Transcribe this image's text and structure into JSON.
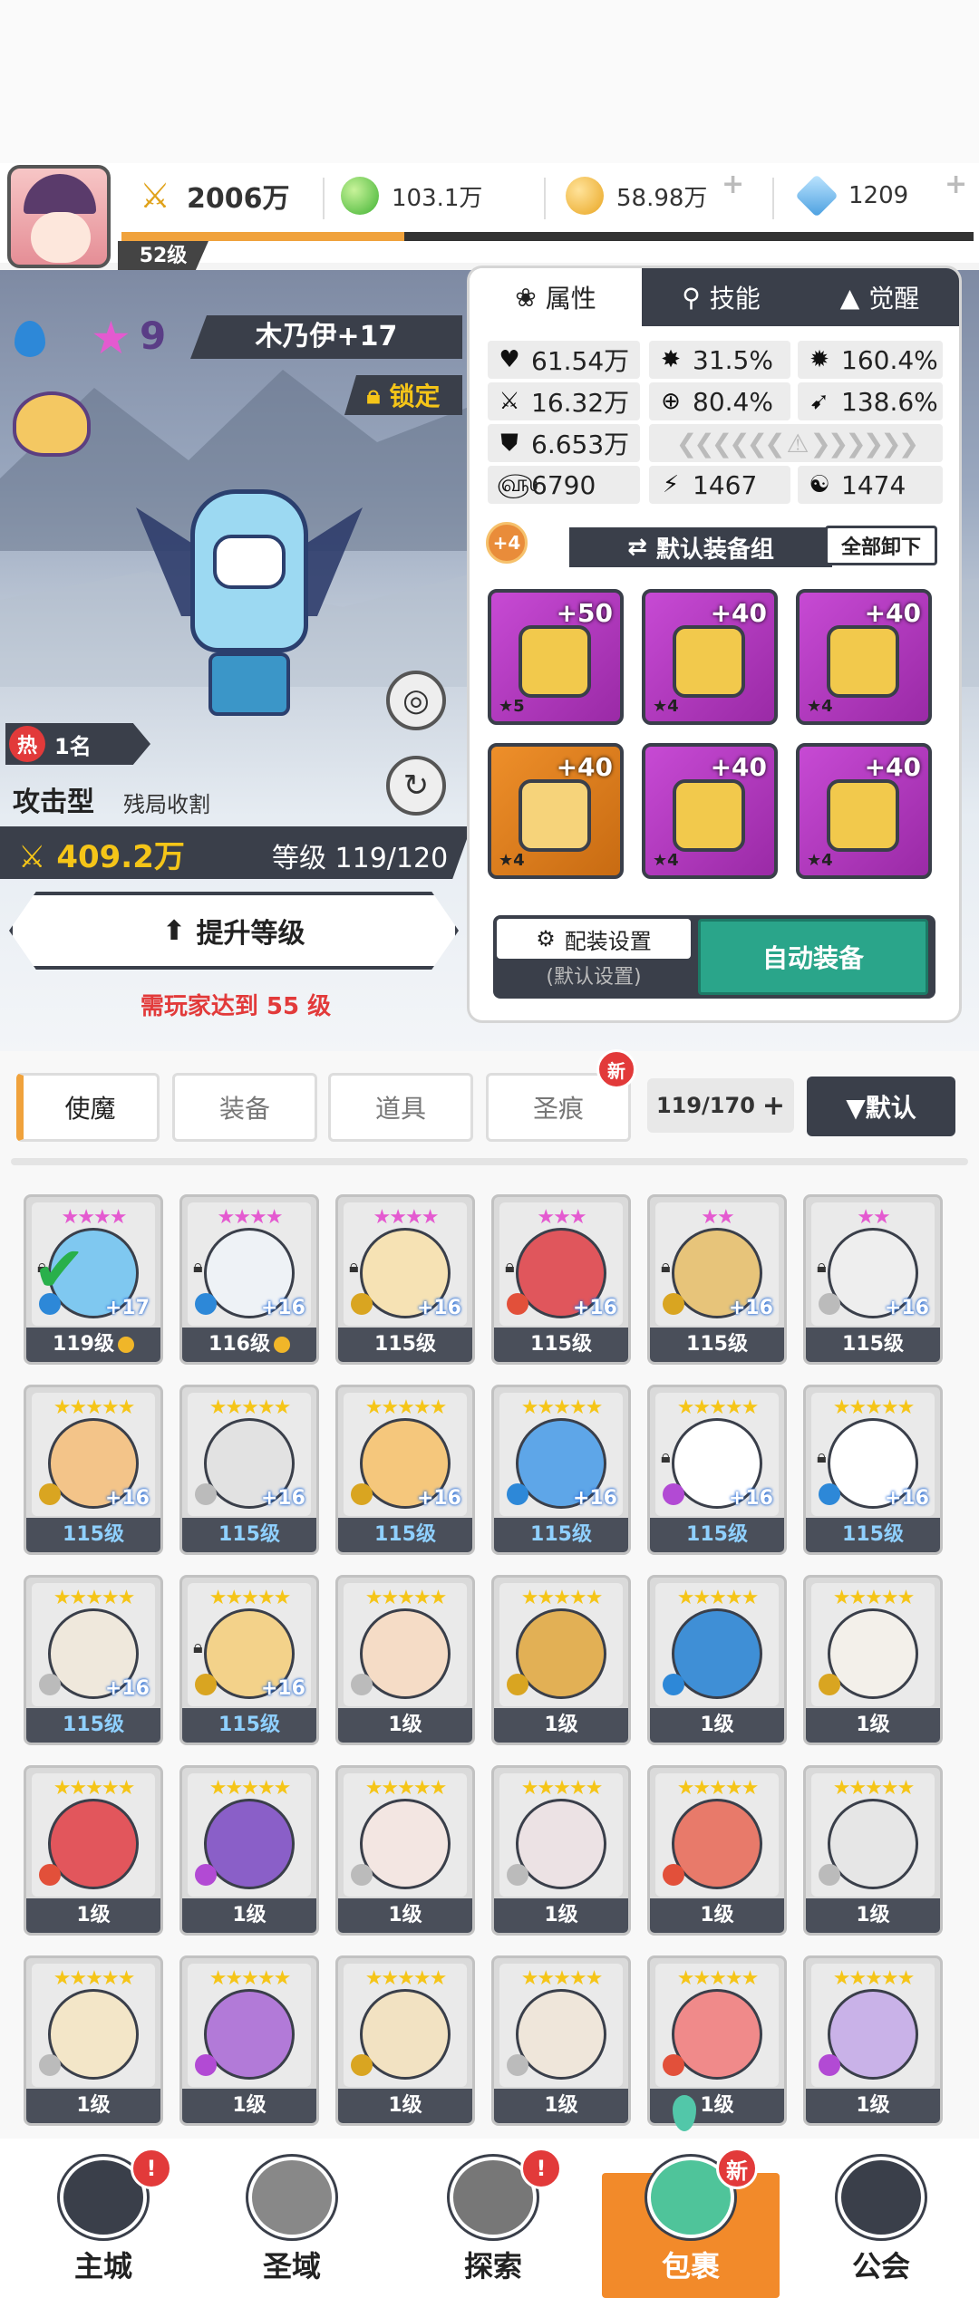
{
  "player": {
    "level": "52级"
  },
  "resources": {
    "power": "2006万",
    "gems": "103.1万",
    "gold": "58.98万",
    "crystal": "1209"
  },
  "hero": {
    "stars": "9",
    "name": "木乃伊+17",
    "lock_label": "锁定",
    "rank": "1名",
    "hot_label": "热",
    "role": "攻击型",
    "role_desc": "残局收割",
    "power": "409.2万",
    "level": "等级 119/120",
    "levelup_label": "提升等级",
    "requirement": "需玩家达到 55 级"
  },
  "stat_tabs": {
    "attr": "属性",
    "skill": "技能",
    "awaken": "觉醒"
  },
  "stats": {
    "hp": "61.54万",
    "crit_rate": "31.5%",
    "crit_dmg": "160.4%",
    "atk": "16.32万",
    "accuracy": "80.4%",
    "speed_pct": "138.6%",
    "def": "6.653万",
    "r1": "6790",
    "r2": "1467",
    "r3": "1474"
  },
  "equip": {
    "plus_badge": "+4",
    "set_name": "默认装备组",
    "unequip_all": "全部卸下",
    "items": [
      {
        "plus": "+50",
        "stars": "★5",
        "rarity": "purple",
        "icon": "sword-icon"
      },
      {
        "plus": "+40",
        "stars": "★4",
        "rarity": "purple",
        "icon": "helmet-icon"
      },
      {
        "plus": "+40",
        "stars": "★4",
        "rarity": "purple",
        "icon": "armor-icon"
      },
      {
        "plus": "+40",
        "stars": "★4",
        "rarity": "orange",
        "icon": "belt-icon"
      },
      {
        "plus": "+40",
        "stars": "★4",
        "rarity": "purple",
        "icon": "necklace-icon"
      },
      {
        "plus": "+40",
        "stars": "★4",
        "rarity": "purple",
        "icon": "boots-icon"
      }
    ],
    "config_label": "配装设置",
    "config_sub": "(默认设置)",
    "auto_equip": "自动装备"
  },
  "categories": {
    "shima": "使魔",
    "equip": "装备",
    "item": "道具",
    "sheng": "圣痕",
    "new_badge": "新"
  },
  "count": "119/170",
  "sort_label": "▼默认",
  "heroes": [
    {
      "stars": "★★★★",
      "level": "119级",
      "plus": "+17",
      "lock": true,
      "coin": true,
      "color": "#7fc8f0",
      "elem": "#2d88d8",
      "blue": false,
      "starColor": "#e45ad0"
    },
    {
      "stars": "★★★★",
      "level": "116级",
      "plus": "+16",
      "lock": true,
      "coin": true,
      "color": "#eef2f6",
      "elem": "#2d88d8",
      "blue": false,
      "starColor": "#e45ad0"
    },
    {
      "stars": "★★★★",
      "level": "115级",
      "plus": "+16",
      "lock": true,
      "coin": false,
      "color": "#f6e2b4",
      "elem": "#d9a521",
      "blue": false,
      "starColor": "#e45ad0"
    },
    {
      "stars": "★★★",
      "level": "115级",
      "plus": "+16",
      "lock": true,
      "coin": false,
      "color": "#e0565c",
      "elem": "#e2503a",
      "blue": false,
      "starColor": "#e45ad0"
    },
    {
      "stars": "★★",
      "level": "115级",
      "plus": "+16",
      "lock": true,
      "coin": false,
      "color": "#e7c47a",
      "elem": "#d9a521",
      "blue": false,
      "starColor": "#e45ad0"
    },
    {
      "stars": "★★",
      "level": "115级",
      "plus": "+16",
      "lock": true,
      "coin": false,
      "color": "#eeeeee",
      "elem": "#bbbbbb",
      "blue": false,
      "starColor": "#e45ad0"
    },
    {
      "stars": "★★★★★",
      "level": "115级",
      "plus": "+16",
      "lock": false,
      "coin": false,
      "color": "#f3c489",
      "elem": "#d9a521",
      "blue": true,
      "starColor": "#f5c518"
    },
    {
      "stars": "★★★★★",
      "level": "115级",
      "plus": "+16",
      "lock": false,
      "coin": false,
      "color": "#e2e2e2",
      "elem": "#bbbbbb",
      "blue": true,
      "starColor": "#f5c518"
    },
    {
      "stars": "★★★★★",
      "level": "115级",
      "plus": "+16",
      "lock": false,
      "coin": false,
      "color": "#f5c77c",
      "elem": "#d9a521",
      "blue": true,
      "starColor": "#f5c518"
    },
    {
      "stars": "★★★★★",
      "level": "115级",
      "plus": "+16",
      "lock": false,
      "coin": false,
      "color": "#5ea6e8",
      "elem": "#2d88d8",
      "blue": true,
      "starColor": "#f5c518"
    },
    {
      "stars": "★★★★★",
      "level": "115级",
      "plus": "+16",
      "lock": true,
      "coin": false,
      "color": "#ffffff",
      "elem": "#b24ad4",
      "blue": true,
      "starColor": "#f5c518"
    },
    {
      "stars": "★★★★★",
      "level": "115级",
      "plus": "+16",
      "lock": true,
      "coin": false,
      "color": "#ffffff",
      "elem": "#2d88d8",
      "blue": true,
      "starColor": "#f5c518"
    },
    {
      "stars": "★★★★★",
      "level": "115级",
      "plus": "+16",
      "lock": false,
      "coin": false,
      "color": "#efe8dc",
      "elem": "#bbbbbb",
      "blue": true,
      "starColor": "#f5c518"
    },
    {
      "stars": "★★★★★",
      "level": "115级",
      "plus": "+16",
      "lock": true,
      "coin": false,
      "color": "#f3d28a",
      "elem": "#d9a521",
      "blue": true,
      "starColor": "#f5c518"
    },
    {
      "stars": "★★★★★",
      "level": "1级",
      "plus": "",
      "lock": false,
      "coin": false,
      "color": "#f5dcc6",
      "elem": "#bbbbbb",
      "blue": false,
      "starColor": "#f5c518"
    },
    {
      "stars": "★★★★★",
      "level": "1级",
      "plus": "",
      "lock": false,
      "coin": false,
      "color": "#e2b055",
      "elem": "#d9a521",
      "blue": false,
      "starColor": "#f5c518"
    },
    {
      "stars": "★★★★★",
      "level": "1级",
      "plus": "",
      "lock": false,
      "coin": false,
      "color": "#3f8fd6",
      "elem": "#2d88d8",
      "blue": false,
      "starColor": "#f5c518"
    },
    {
      "stars": "★★★★★",
      "level": "1级",
      "plus": "",
      "lock": false,
      "coin": false,
      "color": "#f3f0ea",
      "elem": "#d9a521",
      "blue": false,
      "starColor": "#f5c518"
    },
    {
      "stars": "★★★★★",
      "level": "1级",
      "plus": "",
      "lock": false,
      "coin": false,
      "color": "#e2565c",
      "elem": "#e2503a",
      "blue": false,
      "starColor": "#f5c518"
    },
    {
      "stars": "★★★★★",
      "level": "1级",
      "plus": "",
      "lock": false,
      "coin": false,
      "color": "#8a5fc8",
      "elem": "#b24ad4",
      "blue": false,
      "starColor": "#f5c518"
    },
    {
      "stars": "★★★★★",
      "level": "1级",
      "plus": "",
      "lock": false,
      "coin": false,
      "color": "#f3e6e2",
      "elem": "#bbbbbb",
      "blue": false,
      "starColor": "#f5c518"
    },
    {
      "stars": "★★★★★",
      "level": "1级",
      "plus": "",
      "lock": false,
      "coin": false,
      "color": "#ece2e4",
      "elem": "#bbbbbb",
      "blue": false,
      "starColor": "#f5c518"
    },
    {
      "stars": "★★★★★",
      "level": "1级",
      "plus": "",
      "lock": false,
      "coin": false,
      "color": "#e87a6a",
      "elem": "#e2503a",
      "blue": false,
      "starColor": "#f5c518"
    },
    {
      "stars": "★★★★★",
      "level": "1级",
      "plus": "",
      "lock": false,
      "coin": false,
      "color": "#e6e6e6",
      "elem": "#bbbbbb",
      "blue": false,
      "starColor": "#f5c518"
    },
    {
      "stars": "★★★★★",
      "level": "1级",
      "plus": "",
      "lock": false,
      "coin": false,
      "color": "#f3e6c8",
      "elem": "#bbbbbb",
      "blue": false,
      "starColor": "#f5c518"
    },
    {
      "stars": "★★★★★",
      "level": "1级",
      "plus": "",
      "lock": false,
      "coin": false,
      "color": "#b27ad8",
      "elem": "#b24ad4",
      "blue": false,
      "starColor": "#f5c518"
    },
    {
      "stars": "★★★★★",
      "level": "1级",
      "plus": "",
      "lock": false,
      "coin": false,
      "color": "#f2e2c2",
      "elem": "#d9a521",
      "blue": false,
      "starColor": "#f5c518"
    },
    {
      "stars": "★★★★★",
      "level": "1级",
      "plus": "",
      "lock": false,
      "coin": false,
      "color": "#efe6da",
      "elem": "#bbbbbb",
      "blue": false,
      "starColor": "#f5c518"
    },
    {
      "stars": "★★★★★",
      "level": "1级",
      "plus": "",
      "lock": false,
      "coin": false,
      "color": "#f08a8a",
      "elem": "#e2503a",
      "blue": false,
      "starColor": "#f5c518"
    },
    {
      "stars": "★★★★★",
      "level": "1级",
      "plus": "",
      "lock": false,
      "coin": false,
      "color": "#c9b2e8",
      "elem": "#b24ad4",
      "blue": false,
      "starColor": "#f5c518"
    }
  ],
  "nav": {
    "city": "主城",
    "holy": "圣域",
    "explore": "探索",
    "bag": "包裹",
    "guild": "公会",
    "alert": "!",
    "new": "新"
  },
  "colors": {
    "accent": "#f0a23c",
    "dark": "#3a3f4a",
    "green": "#2aa58a",
    "red": "#e23a3a"
  }
}
